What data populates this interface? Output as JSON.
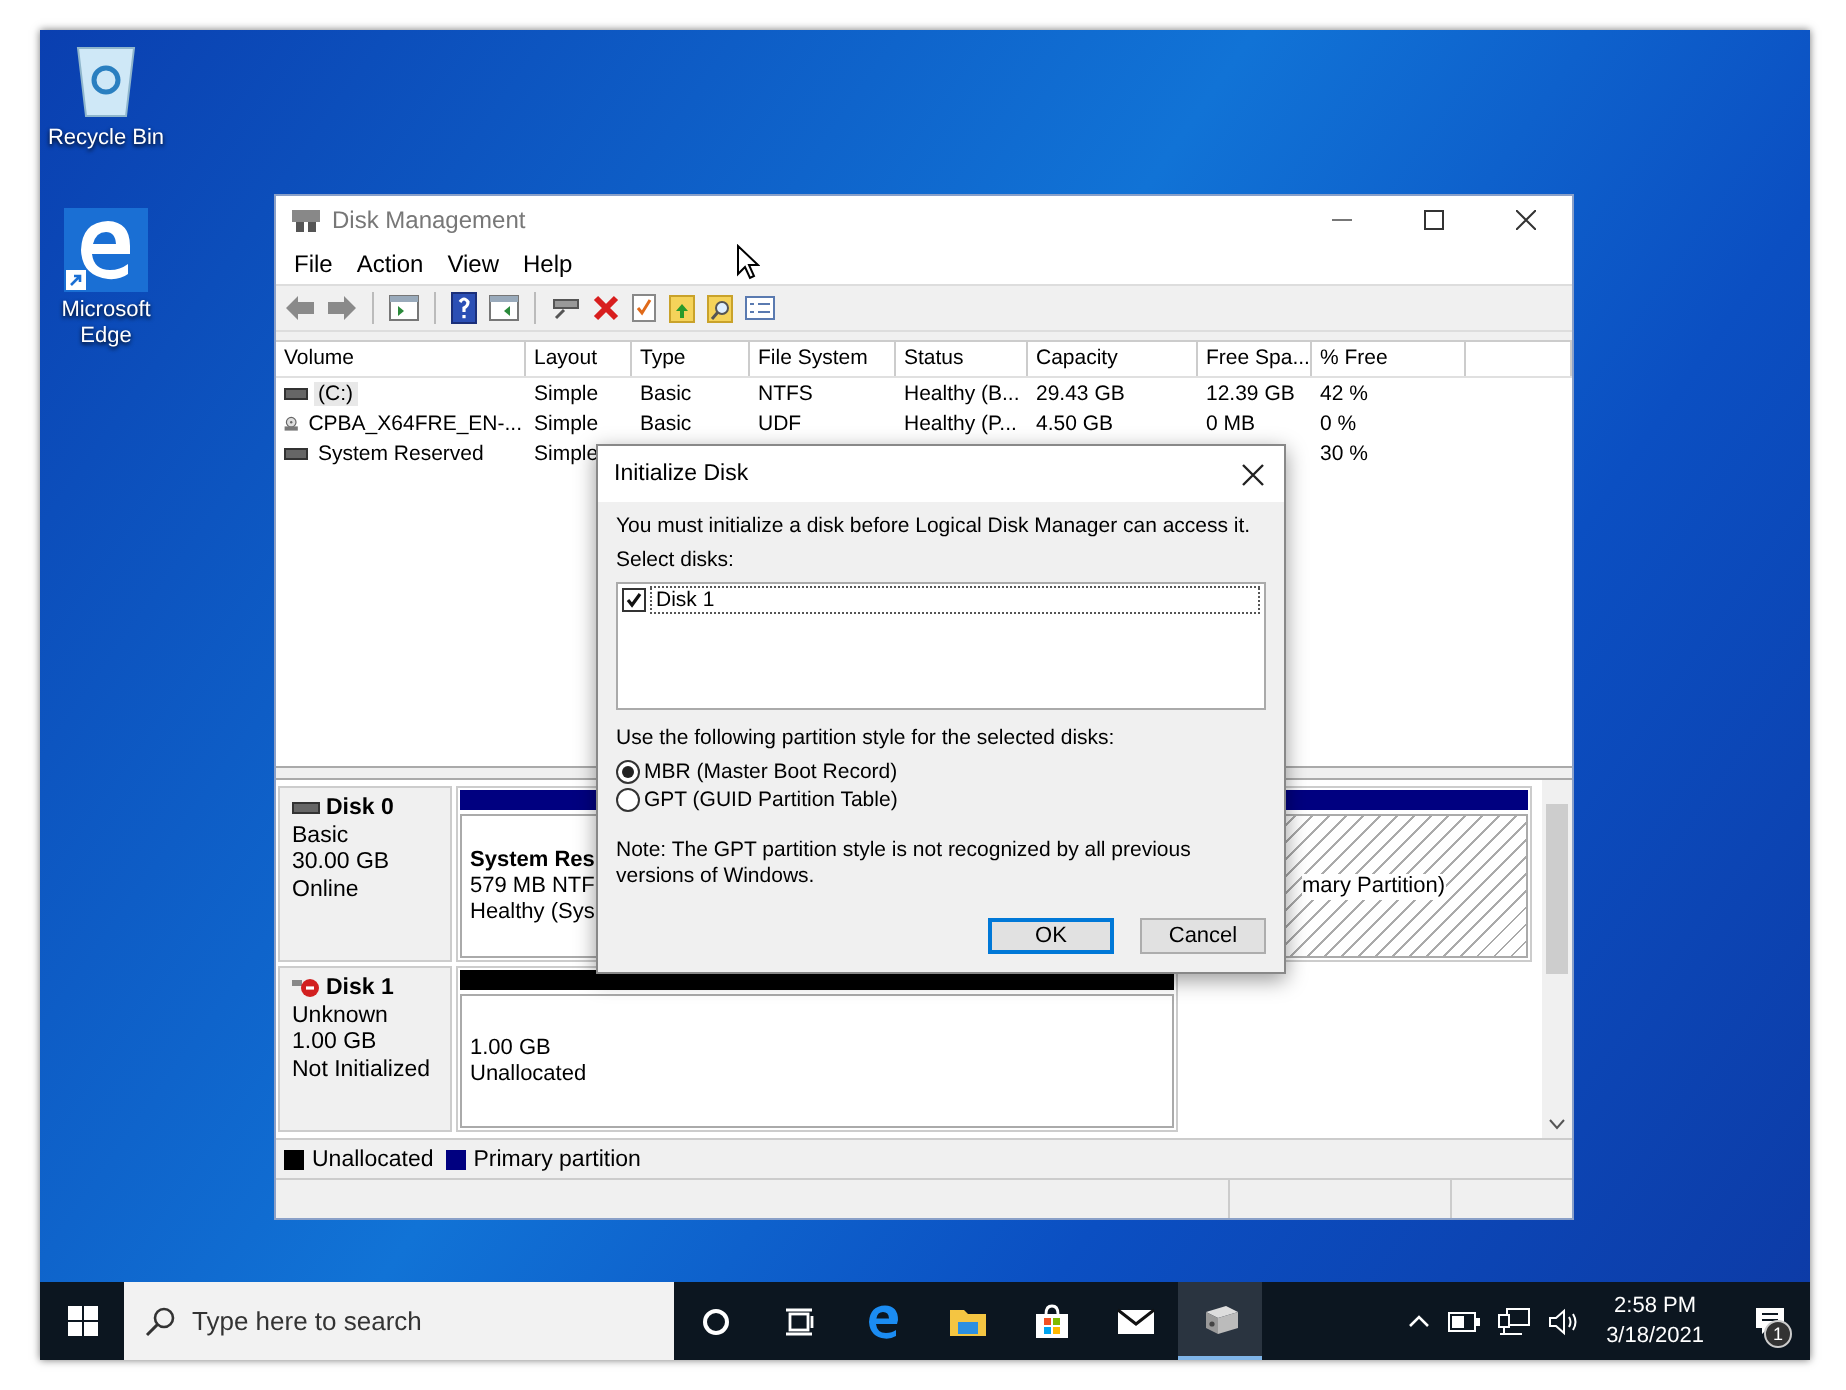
{
  "desktop_icons": [
    {
      "label": "Recycle Bin",
      "kind": "recycle-bin"
    },
    {
      "label": "Microsoft Edge",
      "kind": "edge"
    }
  ],
  "window": {
    "title": "Disk Management",
    "menu": [
      "File",
      "Action",
      "View",
      "Help"
    ],
    "toolbar": [
      {
        "kind": "back"
      },
      {
        "kind": "forward"
      },
      {
        "kind": "sep"
      },
      {
        "kind": "tree"
      },
      {
        "kind": "sep"
      },
      {
        "kind": "help"
      },
      {
        "kind": "panel"
      },
      {
        "kind": "sep"
      },
      {
        "kind": "connect"
      },
      {
        "kind": "delete"
      },
      {
        "kind": "check"
      },
      {
        "kind": "folder-up"
      },
      {
        "kind": "folder-search"
      },
      {
        "kind": "properties"
      }
    ],
    "volume_table": {
      "columns": [
        "Volume",
        "Layout",
        "Type",
        "File System",
        "Status",
        "Capacity",
        "Free Spa...",
        "% Free"
      ],
      "rows": [
        {
          "kind": "disk",
          "selected": true,
          "cells": [
            "(C:)",
            "Simple",
            "Basic",
            "NTFS",
            "Healthy (B...",
            "29.43 GB",
            "12.39 GB",
            "42 %"
          ]
        },
        {
          "kind": "cd",
          "selected": false,
          "cells": [
            "CPBA_X64FRE_EN-...",
            "Simple",
            "Basic",
            "UDF",
            "Healthy (P...",
            "4.50 GB",
            "0 MB",
            "0 %"
          ]
        },
        {
          "kind": "disk",
          "selected": false,
          "cells": [
            "System Reserved",
            "Simple",
            null,
            null,
            null,
            null,
            null,
            "30 %"
          ]
        }
      ]
    },
    "disks": [
      {
        "name": "Disk 0",
        "kind": "online",
        "info": [
          "Basic",
          "30.00 GB",
          "Online"
        ],
        "partitions": [
          {
            "kind": "primary",
            "selected": false,
            "title": "System Res",
            "lines": [
              "579 MB NTF",
              "Healthy (Sys"
            ]
          },
          {
            "kind": "primary",
            "selected": true,
            "lines": [
              "mary Partition)"
            ]
          }
        ]
      },
      {
        "name": "Disk 1",
        "kind": "not-initialized",
        "info": [
          "Unknown",
          "1.00 GB",
          "Not Initialized"
        ],
        "partitions": [
          {
            "kind": "unallocated",
            "selected": false,
            "lines": [
              "1.00 GB",
              "Unallocated"
            ]
          }
        ]
      }
    ],
    "legend": [
      {
        "label": "Unallocated",
        "color": "#000000"
      },
      {
        "label": "Primary partition",
        "color": "#000080"
      }
    ]
  },
  "dialog": {
    "title": "Initialize Disk",
    "message": "You must initialize a disk before Logical Disk Manager can access it.",
    "select_label": "Select disks:",
    "disks": [
      {
        "label": "Disk 1",
        "checked": true
      }
    ],
    "style_label": "Use the following partition style for the selected disks:",
    "options": [
      {
        "label": "MBR (Master Boot Record)",
        "selected": true
      },
      {
        "label": "GPT (GUID Partition Table)",
        "selected": false
      }
    ],
    "note": "Note: The GPT partition style is not recognized by all previous versions of Windows.",
    "buttons": [
      {
        "label": "OK",
        "default": true
      },
      {
        "label": "Cancel",
        "default": false
      }
    ]
  },
  "taskbar": {
    "search": {
      "placeholder": "Type here to search"
    },
    "apps": [
      {
        "kind": "cortana",
        "selected": false
      },
      {
        "kind": "task-view",
        "selected": false
      },
      {
        "kind": "edge",
        "selected": false
      },
      {
        "kind": "explorer",
        "selected": false
      },
      {
        "kind": "store",
        "selected": false
      },
      {
        "kind": "mail",
        "selected": false
      },
      {
        "kind": "disk-management",
        "selected": true
      }
    ],
    "clock": {
      "time": "2:58 PM",
      "date": "3/18/2021"
    },
    "notifications": {
      "count": "1"
    }
  }
}
